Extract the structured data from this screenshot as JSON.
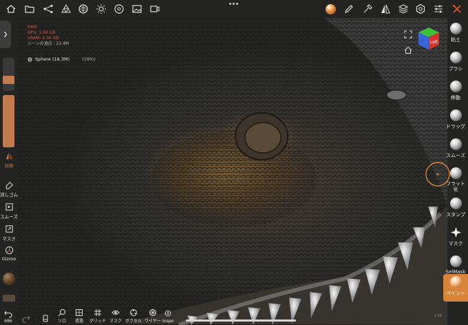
{
  "stats": {
    "line1": "RAM",
    "line2": "GPU: 1.66 GB",
    "line3": "VRAM: 4.36 GB",
    "line4": "シーンの頂点 : 21.4M"
  },
  "sphere": {
    "name": "Sphere (16.3M)",
    "percent": "(19%)"
  },
  "nav_cube": {
    "face_label": "Left",
    "left_color": "#d8322b",
    "top_color": "#3fbf3a",
    "side_color": "#3866d6"
  },
  "left_tools": {
    "symmetry": "対称",
    "erase": "消しゴム",
    "smooth": "スムーズ",
    "mask": "マスク",
    "gizmo": "Gizmo"
  },
  "right_tools": [
    {
      "label": "粘土"
    },
    {
      "label": "ブラシ"
    },
    {
      "label": "移動"
    },
    {
      "label": "ドラッグ"
    },
    {
      "label": "スムーズ"
    },
    {
      "label": "フラット化"
    },
    {
      "label": "スタンプ"
    },
    {
      "label": "マスク"
    },
    {
      "label": "SelMask"
    },
    {
      "label": "ペイント"
    }
  ],
  "bottom_tools": {
    "undo_count": "686",
    "solo": "ソロ",
    "transparent": "透過",
    "grid": "グリッド",
    "mask": "マスク",
    "voxel": "ボクセル",
    "wire": "ワイヤー",
    "inspect": "Inspe"
  },
  "colors": {
    "accent_orange": "#e0852e",
    "close_icon": "#e0542e",
    "slider_fill": "#c17c4f"
  },
  "version_text": "1.64"
}
